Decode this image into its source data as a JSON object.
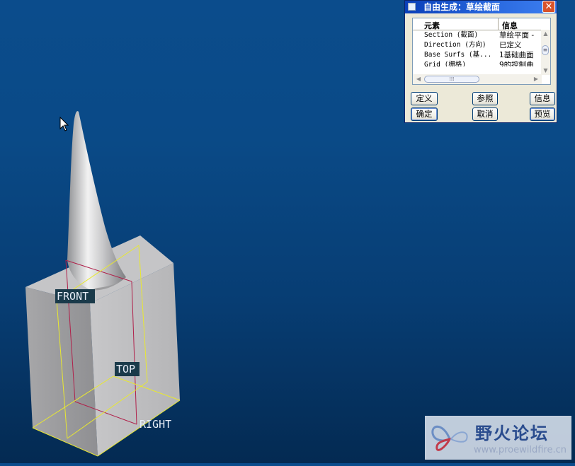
{
  "dialog": {
    "title": "自由生成：草绘截面",
    "close_glyph": "✕",
    "columns": [
      "元素",
      "信息"
    ],
    "rows": [
      {
        "element": "Section (截面)",
        "info": "草绘平面 -"
      },
      {
        "element": "Direction (方向)",
        "info": "已定义"
      },
      {
        "element": "Base Surfs (基...",
        "info": "1基础曲面"
      },
      {
        "element": "Grid (栅格)",
        "info": "9的控制曲"
      }
    ],
    "buttons": {
      "define": "定义",
      "reference": "参照",
      "info": "信息",
      "ok": "确定",
      "cancel": "取消",
      "preview": "预览"
    }
  },
  "viewport": {
    "datum_labels": {
      "front": "FRONT",
      "top": "TOP",
      "right": "RIGHT"
    }
  },
  "watermark": {
    "brand": "野火论坛",
    "url": "www.proewildfire.cn"
  },
  "colors": {
    "background": "#073d73",
    "datum_front": "#b0204a",
    "datum_top": "#e8e830",
    "titlebar": "#0a3fb8"
  }
}
